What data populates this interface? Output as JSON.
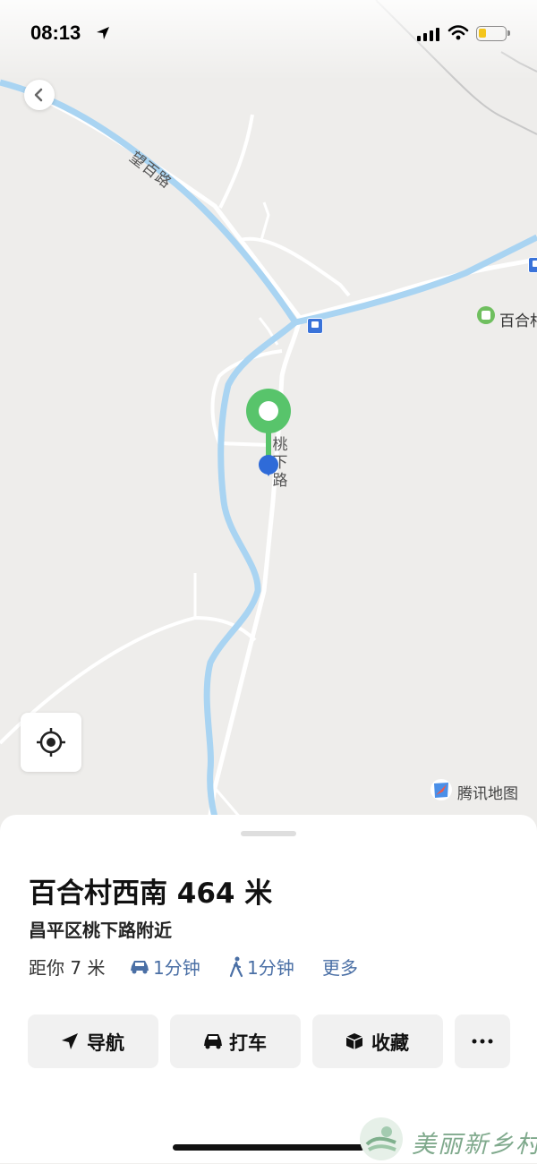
{
  "status_bar": {
    "time": "08:13"
  },
  "map": {
    "road_labels": {
      "diagonal": "望百路",
      "vertical": "桃下路"
    },
    "poi_label": "百合村",
    "brand": "腾讯地图",
    "colors": {
      "background": "#eeedeb",
      "river": "#a9d4f2",
      "road": "#ffffff",
      "pin_green": "#58c46b",
      "user_dot": "#2f6bd8"
    }
  },
  "place": {
    "title": "百合村西南 464 米",
    "subtitle": "昌平区桃下路附近",
    "distance": "距你 7 米",
    "car_time": "1分钟",
    "walk_time": "1分钟",
    "more": "更多"
  },
  "actions": {
    "navigate": "导航",
    "taxi": "打车",
    "favorite": "收藏"
  },
  "watermark": {
    "text": "美丽新乡村"
  },
  "icons": [
    "location-arrow-icon",
    "cellular-signal-icon",
    "wifi-icon",
    "battery-icon",
    "back-chevron-icon",
    "locate-icon",
    "tencent-map-logo-icon",
    "pin-icon",
    "car-icon",
    "walk-icon",
    "navigate-arrow-icon",
    "taxi-icon",
    "favorite-box-icon",
    "more-dots-icon"
  ]
}
